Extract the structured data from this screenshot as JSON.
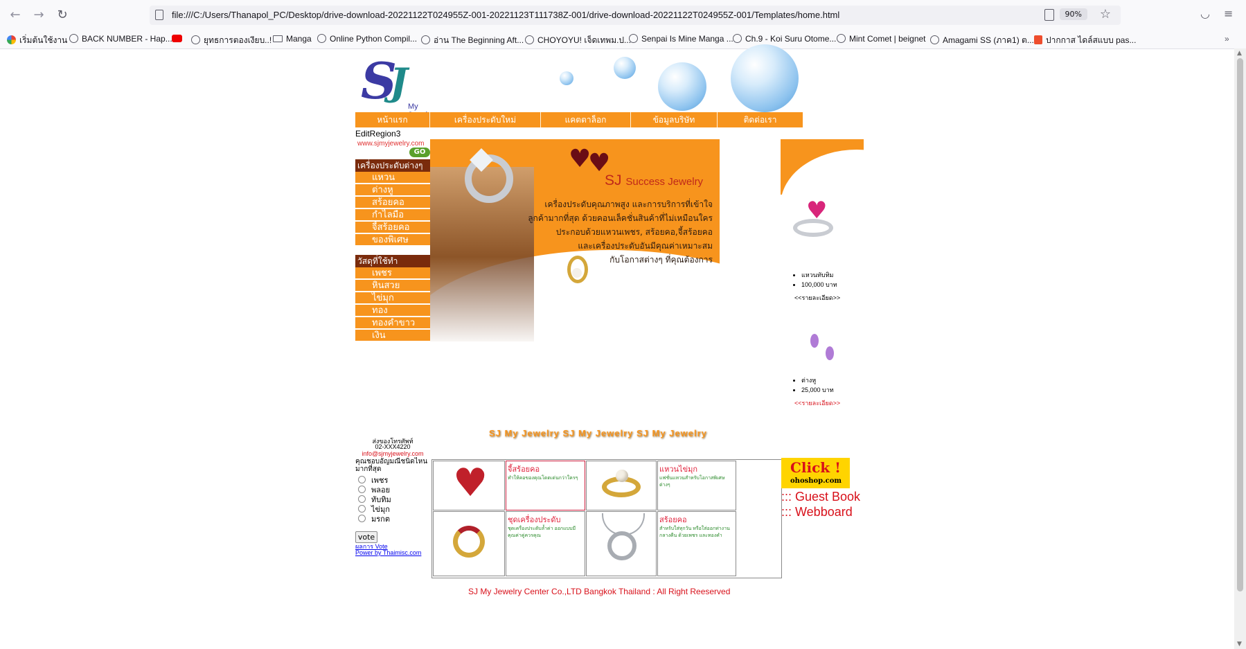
{
  "browser": {
    "url": "file:///C:/Users/Thanapol_PC/Desktop/drive-download-20221122T024955Z-001-20221123T111738Z-001/drive-download-20221122T024955Z-001/Templates/home.html",
    "zoom": "90%",
    "bookmarks": [
      "เริ่มต้นใช้งาน",
      "BACK NUMBER - Hap...",
      "",
      "ยุทธการตองเงียบ..!",
      "Manga",
      "Online Python Compil...",
      "อ่าน The Beginning Aft...",
      "CHOYOYU! เจ็ดเทพม.ป...",
      "Senpai Is Mine Manga ...",
      "Ch.9 - Koi Suru Otome...",
      "Mint Comet | beignet",
      "Amagami SS (ภาค1) ต...",
      "ปากกาส ไดล์สแบบ pas..."
    ]
  },
  "nav": [
    "หน้าแรก",
    "เครื่องประดับใหม่",
    "แคตตาล็อก",
    "ข้อมูลบริษัท",
    "ติดต่อเรา"
  ],
  "edit_region": "EditRegion3",
  "site_url": "www.sjmyjewelry.com",
  "go": "GO",
  "logo_text": "My Jewelry",
  "menu": {
    "jewelry_head": "เครื่องประดับต่างๆ",
    "jewelry_items": [
      "แหวน",
      "ต่างหู",
      "สร้อยคอ",
      "กำไลมือ",
      "จี้สร้อยคอ",
      "ของพิเศษ"
    ],
    "material_head": "วัสดุที่ใช้ทำ",
    "material_items": [
      "เพชร",
      "หินสวย",
      "ไข่มุก",
      "ทอง",
      "ทองคำขาว",
      "เงิน"
    ]
  },
  "banner": {
    "brand": "SJ",
    "brand_rest": "Success Jewelry",
    "lines": [
      "เครื่องประดับคุณภาพสูง และการบริการที่เข้าใจ",
      "ลูกค้ามากที่สุด ด้วยคอนเล็คชั่นสินค้าที่ไม่เหมือนใคร",
      "ประกอบด้วยแหวนเพชร, สร้อยคอ,จี้สร้อยคอ",
      "และเครื่องประดับอันมีคุณค่าเหมาะสม",
      "กับโอกาสต่างๆ ที่คุณต้องการ"
    ]
  },
  "products": [
    {
      "name": "แหวนทับทิม",
      "price": "100,000 บาท",
      "link": "<<รายละเอียด>>",
      "color": "#000000"
    },
    {
      "name": "ต่างหู",
      "price": "25,000 บาท",
      "link": "<<รายละเอียด>>",
      "color": "#d8101a"
    }
  ],
  "marquee": "SJ My Jewelry SJ My Jewelry SJ My Jewelry",
  "contact": {
    "phone_label": "ส่งของโทรศัพท์",
    "phone": "02-XXX4220",
    "email": "info@sjmyjewelry.com"
  },
  "poll": {
    "question": "คุณชอบอัญมณีชนิดไหนมากที่สุด",
    "options": [
      "เพชร",
      "พลอย",
      "ทับทิม",
      "ไข่มุก",
      "มรกต"
    ],
    "vote": "vote",
    "result_link": "ผลการ Vote",
    "power_link": "Power by Thaimisc.com"
  },
  "grid": [
    {
      "title": "",
      "desc": ""
    },
    {
      "title": "จี้สร้อยคอ",
      "desc": "ทำให้คอของคุณโดดเด่นกว่าใครๆ"
    },
    {
      "title": "",
      "desc": ""
    },
    {
      "title": "แหวนไข่มุก",
      "desc": "แฟชั่นแหวนสำหรับโอกาสพิเศษต่างๆ"
    },
    {
      "title": "",
      "desc": ""
    },
    {
      "title": "ชุดเครื่องประดับ",
      "desc": "ชุดเครื่องประดับล้ำค่า ออกแบบมีคุณค่าคู่ควรคุณ"
    },
    {
      "title": "",
      "desc": ""
    },
    {
      "title": "สร้อยคอ",
      "desc": "สำหรับใส่ทุกวัน หรือใส่ออกท่างานกลางคืน ด้วยเพชร และทองคำ"
    }
  ],
  "click_banner": {
    "line1": "Click !",
    "line2": "ohoshop.com"
  },
  "side_links": [
    "::: Guest Book",
    "::: Webboard"
  ],
  "footer": "SJ My Jewelry Center Co.,LTD Bangkok Thailand : All Right Reeserved",
  "colors": {
    "accent": "#f7941d",
    "menu_head": "#7a2b0c",
    "link_red": "#d8101a"
  }
}
